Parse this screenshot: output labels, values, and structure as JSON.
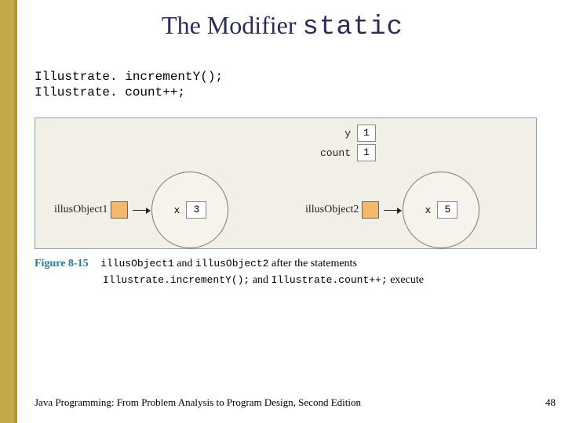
{
  "title": {
    "prefix": "The Modifier ",
    "code": "static"
  },
  "code_lines": {
    "l1": "Illustrate. incrementY();",
    "l2": "Illustrate. count++;"
  },
  "statics": {
    "y": {
      "label": "y",
      "value": "1"
    },
    "count": {
      "label": "count",
      "value": "1"
    }
  },
  "objects": {
    "o1": {
      "label": "illusObject1",
      "xlabel": "x",
      "xvalue": "3"
    },
    "o2": {
      "label": "illusObject2",
      "xlabel": "x",
      "xvalue": "5"
    }
  },
  "caption": {
    "fignum": "Figure 8-15",
    "p1a": "illusObject1",
    "p1b": " and ",
    "p1c": "illusObject2",
    "p1d": " after the statements",
    "p2a": "Illustrate.incrementY();",
    "p2b": " and ",
    "p2c": "Illustrate.count++;",
    "p2d": " execute"
  },
  "footer": "Java Programming: From Problem Analysis to Program Design, Second Edition",
  "page": "48"
}
